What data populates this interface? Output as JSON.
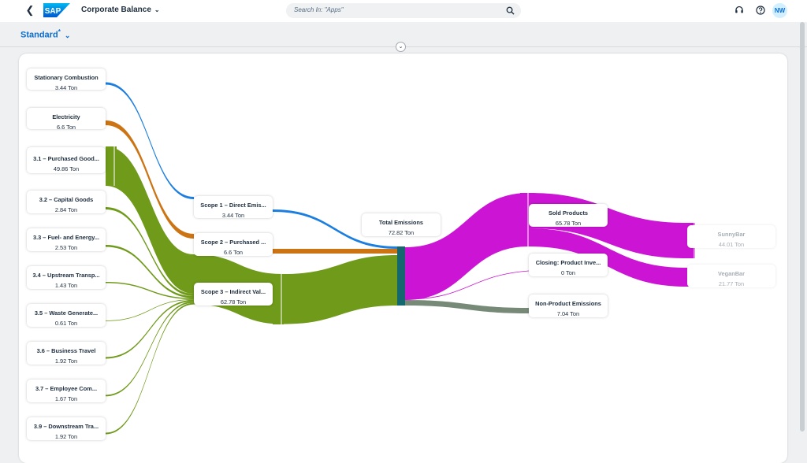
{
  "shell": {
    "logo_text": "SAP",
    "app_title": "Corporate Balance",
    "search_placeholder": "Search In: \"Apps\"",
    "user_initials": "NW"
  },
  "variant": {
    "name": "Standard",
    "modified_marker": "*"
  },
  "colors": {
    "scope1": "#1b7ee0",
    "scope2": "#cc7413",
    "scope3": "#6f9a1a",
    "total": "#15676f",
    "sold": "#cc14d4",
    "non_product": "#778a78"
  },
  "nodes": [
    {
      "id": "stationary",
      "label": "Stationary Combustion",
      "value": "3.44 Ton"
    },
    {
      "id": "electricity",
      "label": "Electricity",
      "value": "6.6 Ton"
    },
    {
      "id": "c31",
      "label": "3.1 – Purchased Good...",
      "value": "49.86 Ton"
    },
    {
      "id": "c32",
      "label": "3.2 – Capital Goods",
      "value": "2.84 Ton"
    },
    {
      "id": "c33",
      "label": "3.3 – Fuel- and Energy...",
      "value": "2.53 Ton"
    },
    {
      "id": "c34",
      "label": "3.4 – Upstream Transp...",
      "value": "1.43 Ton"
    },
    {
      "id": "c35",
      "label": "3.5 – Waste Generate...",
      "value": "0.61 Ton"
    },
    {
      "id": "c36",
      "label": "3.6 – Business Travel",
      "value": "1.92 Ton"
    },
    {
      "id": "c37",
      "label": "3.7 – Employee Com...",
      "value": "1.67 Ton"
    },
    {
      "id": "c39",
      "label": "3.9 – Downstream Tra...",
      "value": "1.92 Ton"
    },
    {
      "id": "scope1",
      "label": "Scope 1 – Direct Emis...",
      "value": "3.44 Ton"
    },
    {
      "id": "scope2",
      "label": "Scope 2 – Purchased ...",
      "value": "6.6 Ton"
    },
    {
      "id": "scope3",
      "label": "Scope 3 – Indirect Val...",
      "value": "62.78 Ton"
    },
    {
      "id": "total",
      "label": "Total Emissions",
      "value": "72.82 Ton"
    },
    {
      "id": "sold",
      "label": "Sold Products",
      "value": "65.78 Ton"
    },
    {
      "id": "closing",
      "label": "Closing: Product Inve...",
      "value": "0 Ton"
    },
    {
      "id": "nonprod",
      "label": "Non-Product Emissions",
      "value": "7.04 Ton"
    },
    {
      "id": "sunnybar",
      "label": "SunnyBar",
      "value": "44.01 Ton"
    },
    {
      "id": "veganbar",
      "label": "VeganBar",
      "value": "21.77 Ton"
    }
  ],
  "flows": [
    {
      "from": "stationary",
      "to": "scope1",
      "value": 3.44
    },
    {
      "from": "electricity",
      "to": "scope2",
      "value": 6.6
    },
    {
      "from": "c31",
      "to": "scope3",
      "value": 49.86
    },
    {
      "from": "c32",
      "to": "scope3",
      "value": 2.84
    },
    {
      "from": "c33",
      "to": "scope3",
      "value": 2.53
    },
    {
      "from": "c34",
      "to": "scope3",
      "value": 1.43
    },
    {
      "from": "c35",
      "to": "scope3",
      "value": 0.61
    },
    {
      "from": "c36",
      "to": "scope3",
      "value": 1.92
    },
    {
      "from": "c37",
      "to": "scope3",
      "value": 1.67
    },
    {
      "from": "c39",
      "to": "scope3",
      "value": 1.92
    },
    {
      "from": "scope1",
      "to": "total",
      "value": 3.44
    },
    {
      "from": "scope2",
      "to": "total",
      "value": 6.6
    },
    {
      "from": "scope3",
      "to": "total",
      "value": 62.78
    },
    {
      "from": "total",
      "to": "sold",
      "value": 65.78
    },
    {
      "from": "total",
      "to": "closing",
      "value": 0
    },
    {
      "from": "total",
      "to": "nonprod",
      "value": 7.04
    },
    {
      "from": "sold",
      "to": "sunnybar",
      "value": 44.01
    },
    {
      "from": "sold",
      "to": "veganbar",
      "value": 21.77
    }
  ]
}
